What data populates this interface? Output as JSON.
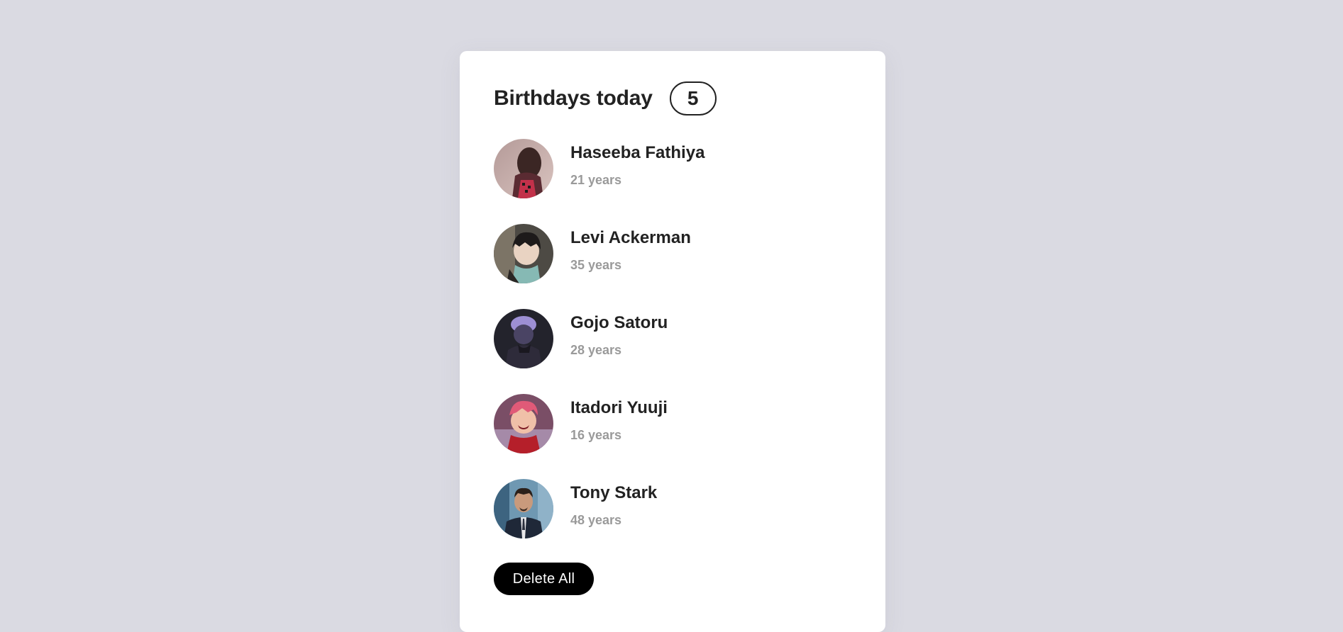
{
  "header": {
    "title": "Birthdays today",
    "count": "5"
  },
  "people": [
    {
      "name": "Haseeba Fathiya",
      "age": "21 years",
      "avatar_icon": "woman-portrait-avatar"
    },
    {
      "name": "Levi Ackerman",
      "age": "35 years",
      "avatar_icon": "anime-man-dark-hair-avatar"
    },
    {
      "name": "Gojo Satoru",
      "age": "28 years",
      "avatar_icon": "anime-man-white-hair-avatar"
    },
    {
      "name": "Itadori Yuuji",
      "age": "16 years",
      "avatar_icon": "anime-boy-pink-hair-avatar"
    },
    {
      "name": "Tony Stark",
      "age": "48 years",
      "avatar_icon": "man-in-suit-avatar"
    }
  ],
  "actions": {
    "delete_all_label": "Delete All"
  },
  "colors": {
    "page_background": "#dadae2",
    "card_background": "#ffffff",
    "text_primary": "#222222",
    "text_secondary": "#9a9a9a",
    "button_background": "#000000",
    "button_text": "#ffffff"
  }
}
